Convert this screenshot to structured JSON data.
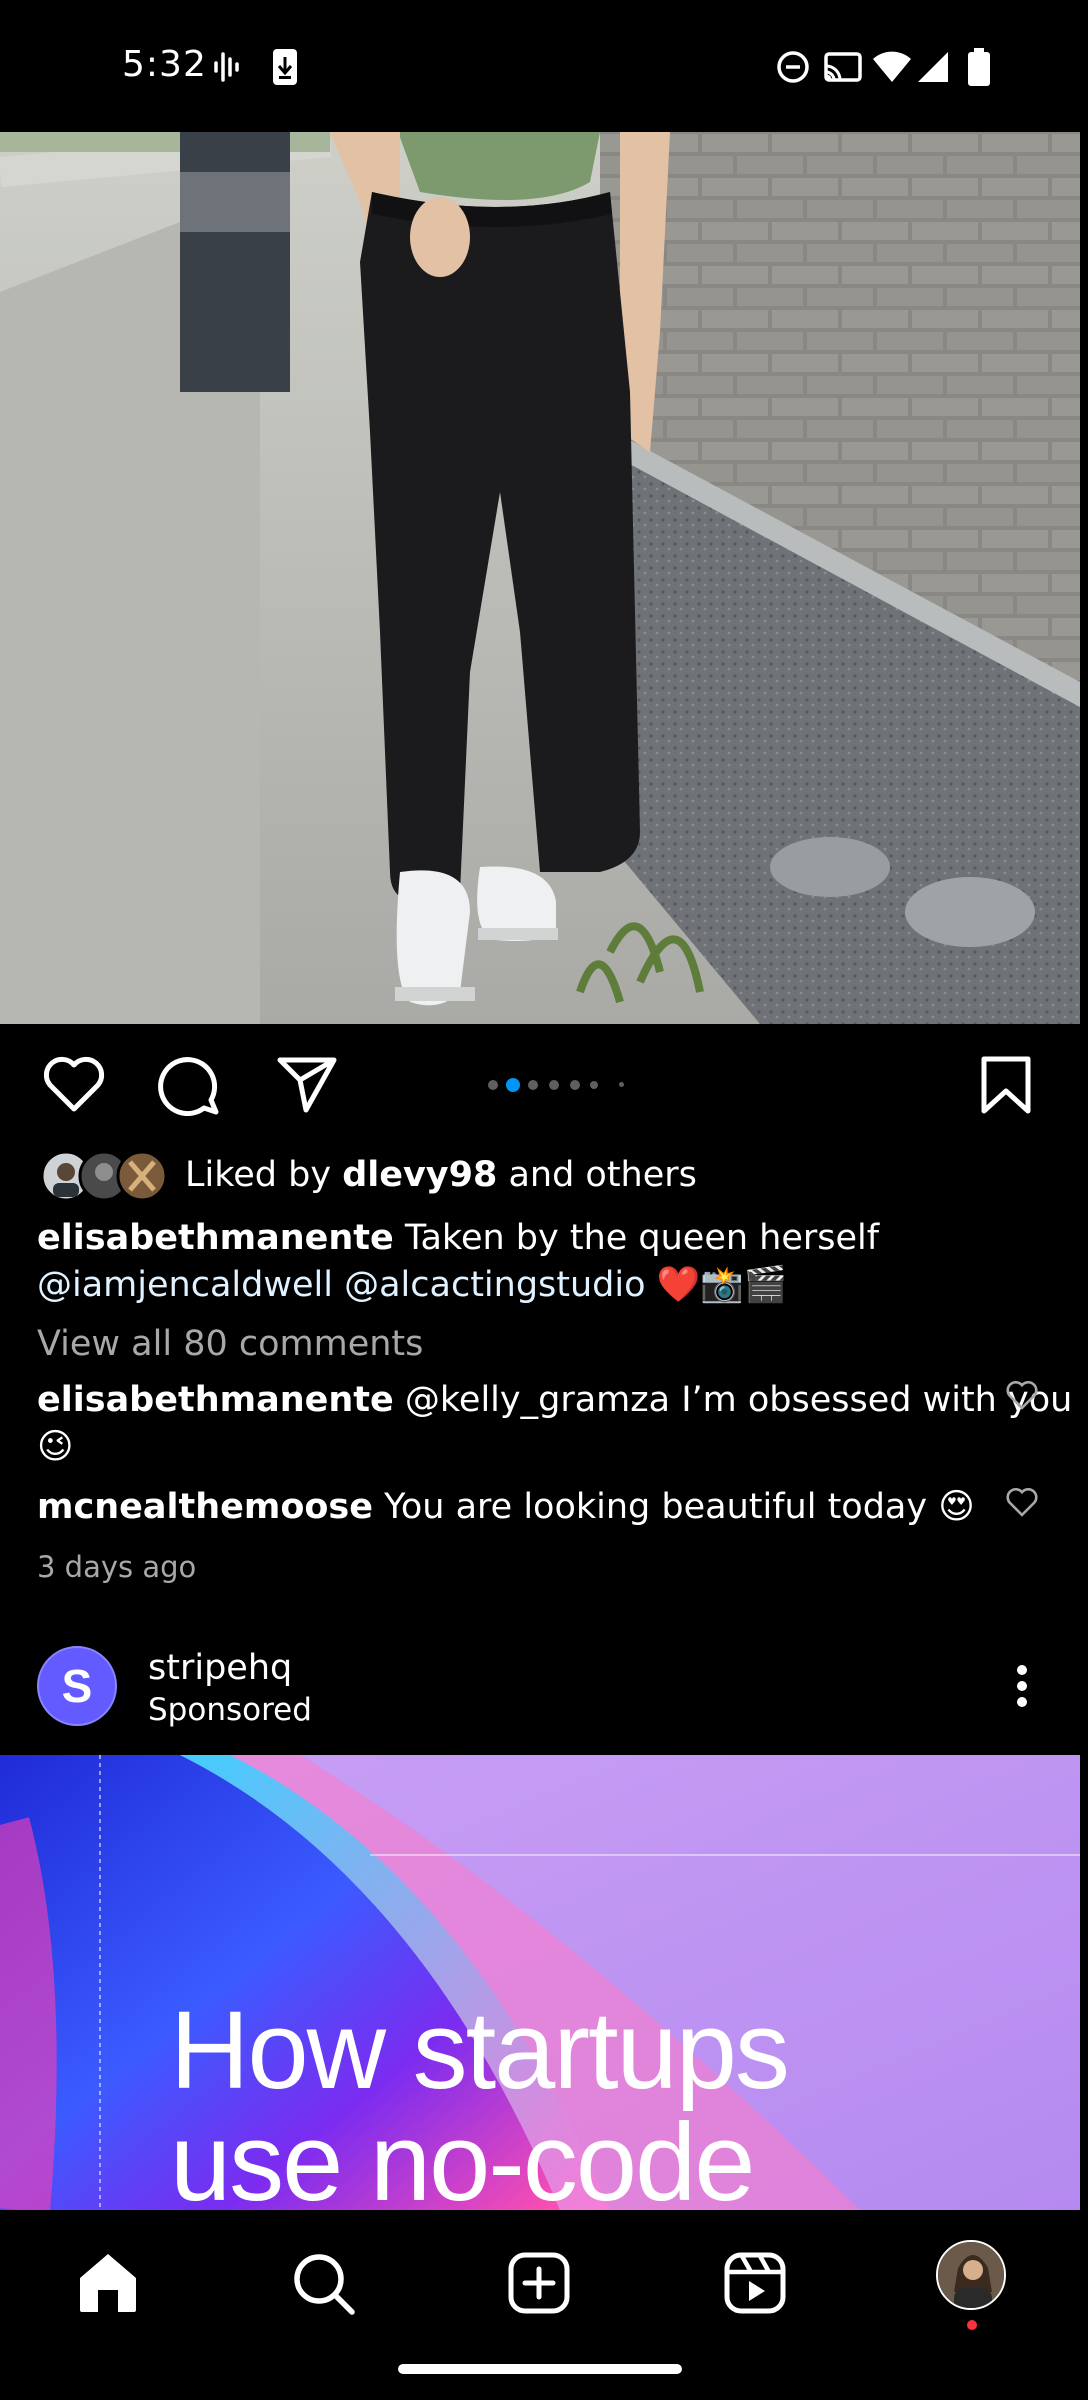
{
  "status_bar": {
    "time": "5:32",
    "left_icons": [
      "voice-wave-icon",
      "download-icon"
    ],
    "right_icons": [
      "do-not-disturb-icon",
      "cast-icon",
      "wifi-icon",
      "signal-icon",
      "battery-icon"
    ]
  },
  "post": {
    "image_alt": "Person in black wide-leg cargo jeans and white sneakers leaning against a brick wall",
    "pager": {
      "count": 6,
      "active_index": 1,
      "active_color": "#0095f6"
    },
    "actions": [
      "like-icon",
      "comment-icon",
      "share-icon",
      "bookmark-icon"
    ],
    "likes": {
      "prefix": "Liked by ",
      "user": "dlevy98",
      "suffix": " and others"
    },
    "caption": {
      "username": "elisabethmanente",
      "text_line1": " Taken by the queen herself",
      "mention1": "@iamjencaldwell",
      "mention2": "@alcactingstudio",
      "emoji": " ❤️📸🎬"
    },
    "view_comments": "View all 80 comments",
    "comments": [
      {
        "username": "elisabethmanente",
        "text": " @kelly_gramza I’m obsessed with you",
        "text_cont": "😉"
      },
      {
        "username": "mcnealthemoose",
        "text": " You are looking beautiful today 😍"
      }
    ],
    "time_ago": "3 days ago"
  },
  "ad": {
    "avatar_letter": "S",
    "avatar_color": "#635bff",
    "username": "stripehq",
    "sponsored": "Sponsored",
    "headline_line1": "How startups",
    "headline_line2": "use no-code"
  },
  "bottom_nav": {
    "items": [
      "home-icon",
      "search-icon",
      "create-icon",
      "reels-icon",
      "profile-avatar"
    ],
    "notification_dot_color": "#ff3040"
  }
}
